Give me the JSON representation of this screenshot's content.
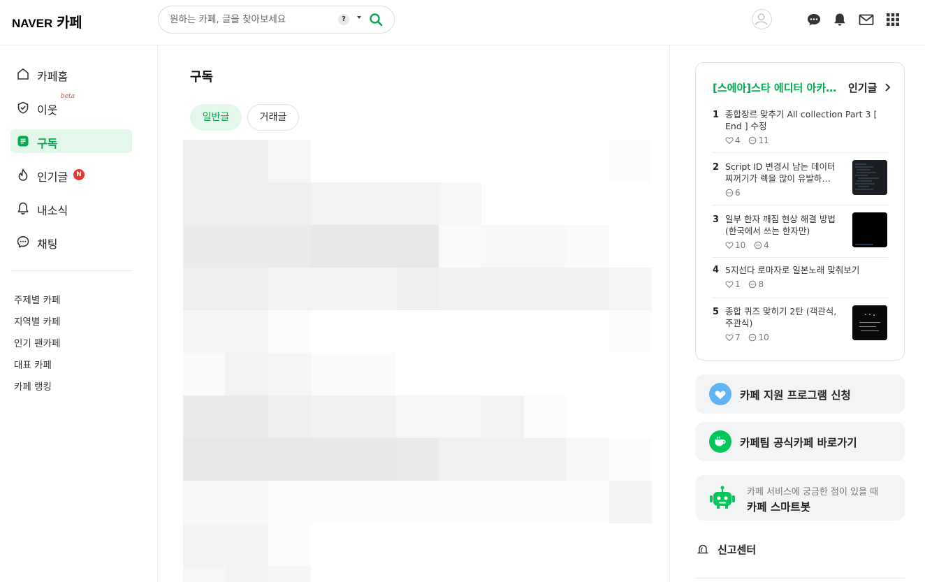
{
  "header": {
    "logo_naver": "NAVER",
    "logo_cafe": "카페",
    "search_placeholder": "원하는 카페, 글을 찾아보세요",
    "help_label": "?"
  },
  "sidebar": {
    "items": [
      {
        "label": "카페홈",
        "icon": "home-icon"
      },
      {
        "label": "이웃",
        "icon": "neighbor-icon",
        "badge": "beta"
      },
      {
        "label": "구독",
        "icon": "subscribe-icon",
        "active": true
      },
      {
        "label": "인기글",
        "icon": "fire-icon",
        "badge": "N"
      },
      {
        "label": "내소식",
        "icon": "bell-icon"
      },
      {
        "label": "채팅",
        "icon": "chat-icon"
      }
    ],
    "links": [
      "주제별 카페",
      "지역별 카페",
      "인기 팬카페",
      "대표 카페",
      "카페 랭킹"
    ]
  },
  "main": {
    "title": "구독",
    "tabs": [
      {
        "label": "일반글",
        "active": true
      },
      {
        "label": "거래글",
        "active": false
      }
    ]
  },
  "popular": {
    "cafe_name": "[스에아]스타 에디터 아카데미",
    "label": "인기글",
    "items": [
      {
        "rank": "1",
        "title": "종합장르 맞추기 All collection Part 3 [ End ] 수정",
        "likes": "4",
        "comments": "11"
      },
      {
        "rank": "2",
        "title": "Script ID 변경시 남는 데이터 찌꺼기가 렉을 많이 유발하…",
        "comments": "6"
      },
      {
        "rank": "3",
        "title": "일부 한자 깨짐 현상 해결 방법 (한국에서 쓰는 한자만)",
        "likes": "10",
        "comments": "4"
      },
      {
        "rank": "4",
        "title": "5지선다 로마자로 일본노래 맞춰보기",
        "likes": "1",
        "comments": "8"
      },
      {
        "rank": "5",
        "title": "종합 퀴즈 맞히기 2탄 (객관식, 주관식)",
        "likes": "7",
        "comments": "10"
      }
    ]
  },
  "cards": {
    "support": "카페 지원 프로그램 신청",
    "official": "카페팀 공식카페 바로가기",
    "bot_sub": "카페 서비스에 궁금한 점이 있을 때",
    "bot_title": "카페 스마트봇"
  },
  "report": "신고센터",
  "colors": {
    "accent": "#03a94d",
    "badge_red": "#e5392f",
    "tab_active_bg": "#e3f8ea"
  }
}
